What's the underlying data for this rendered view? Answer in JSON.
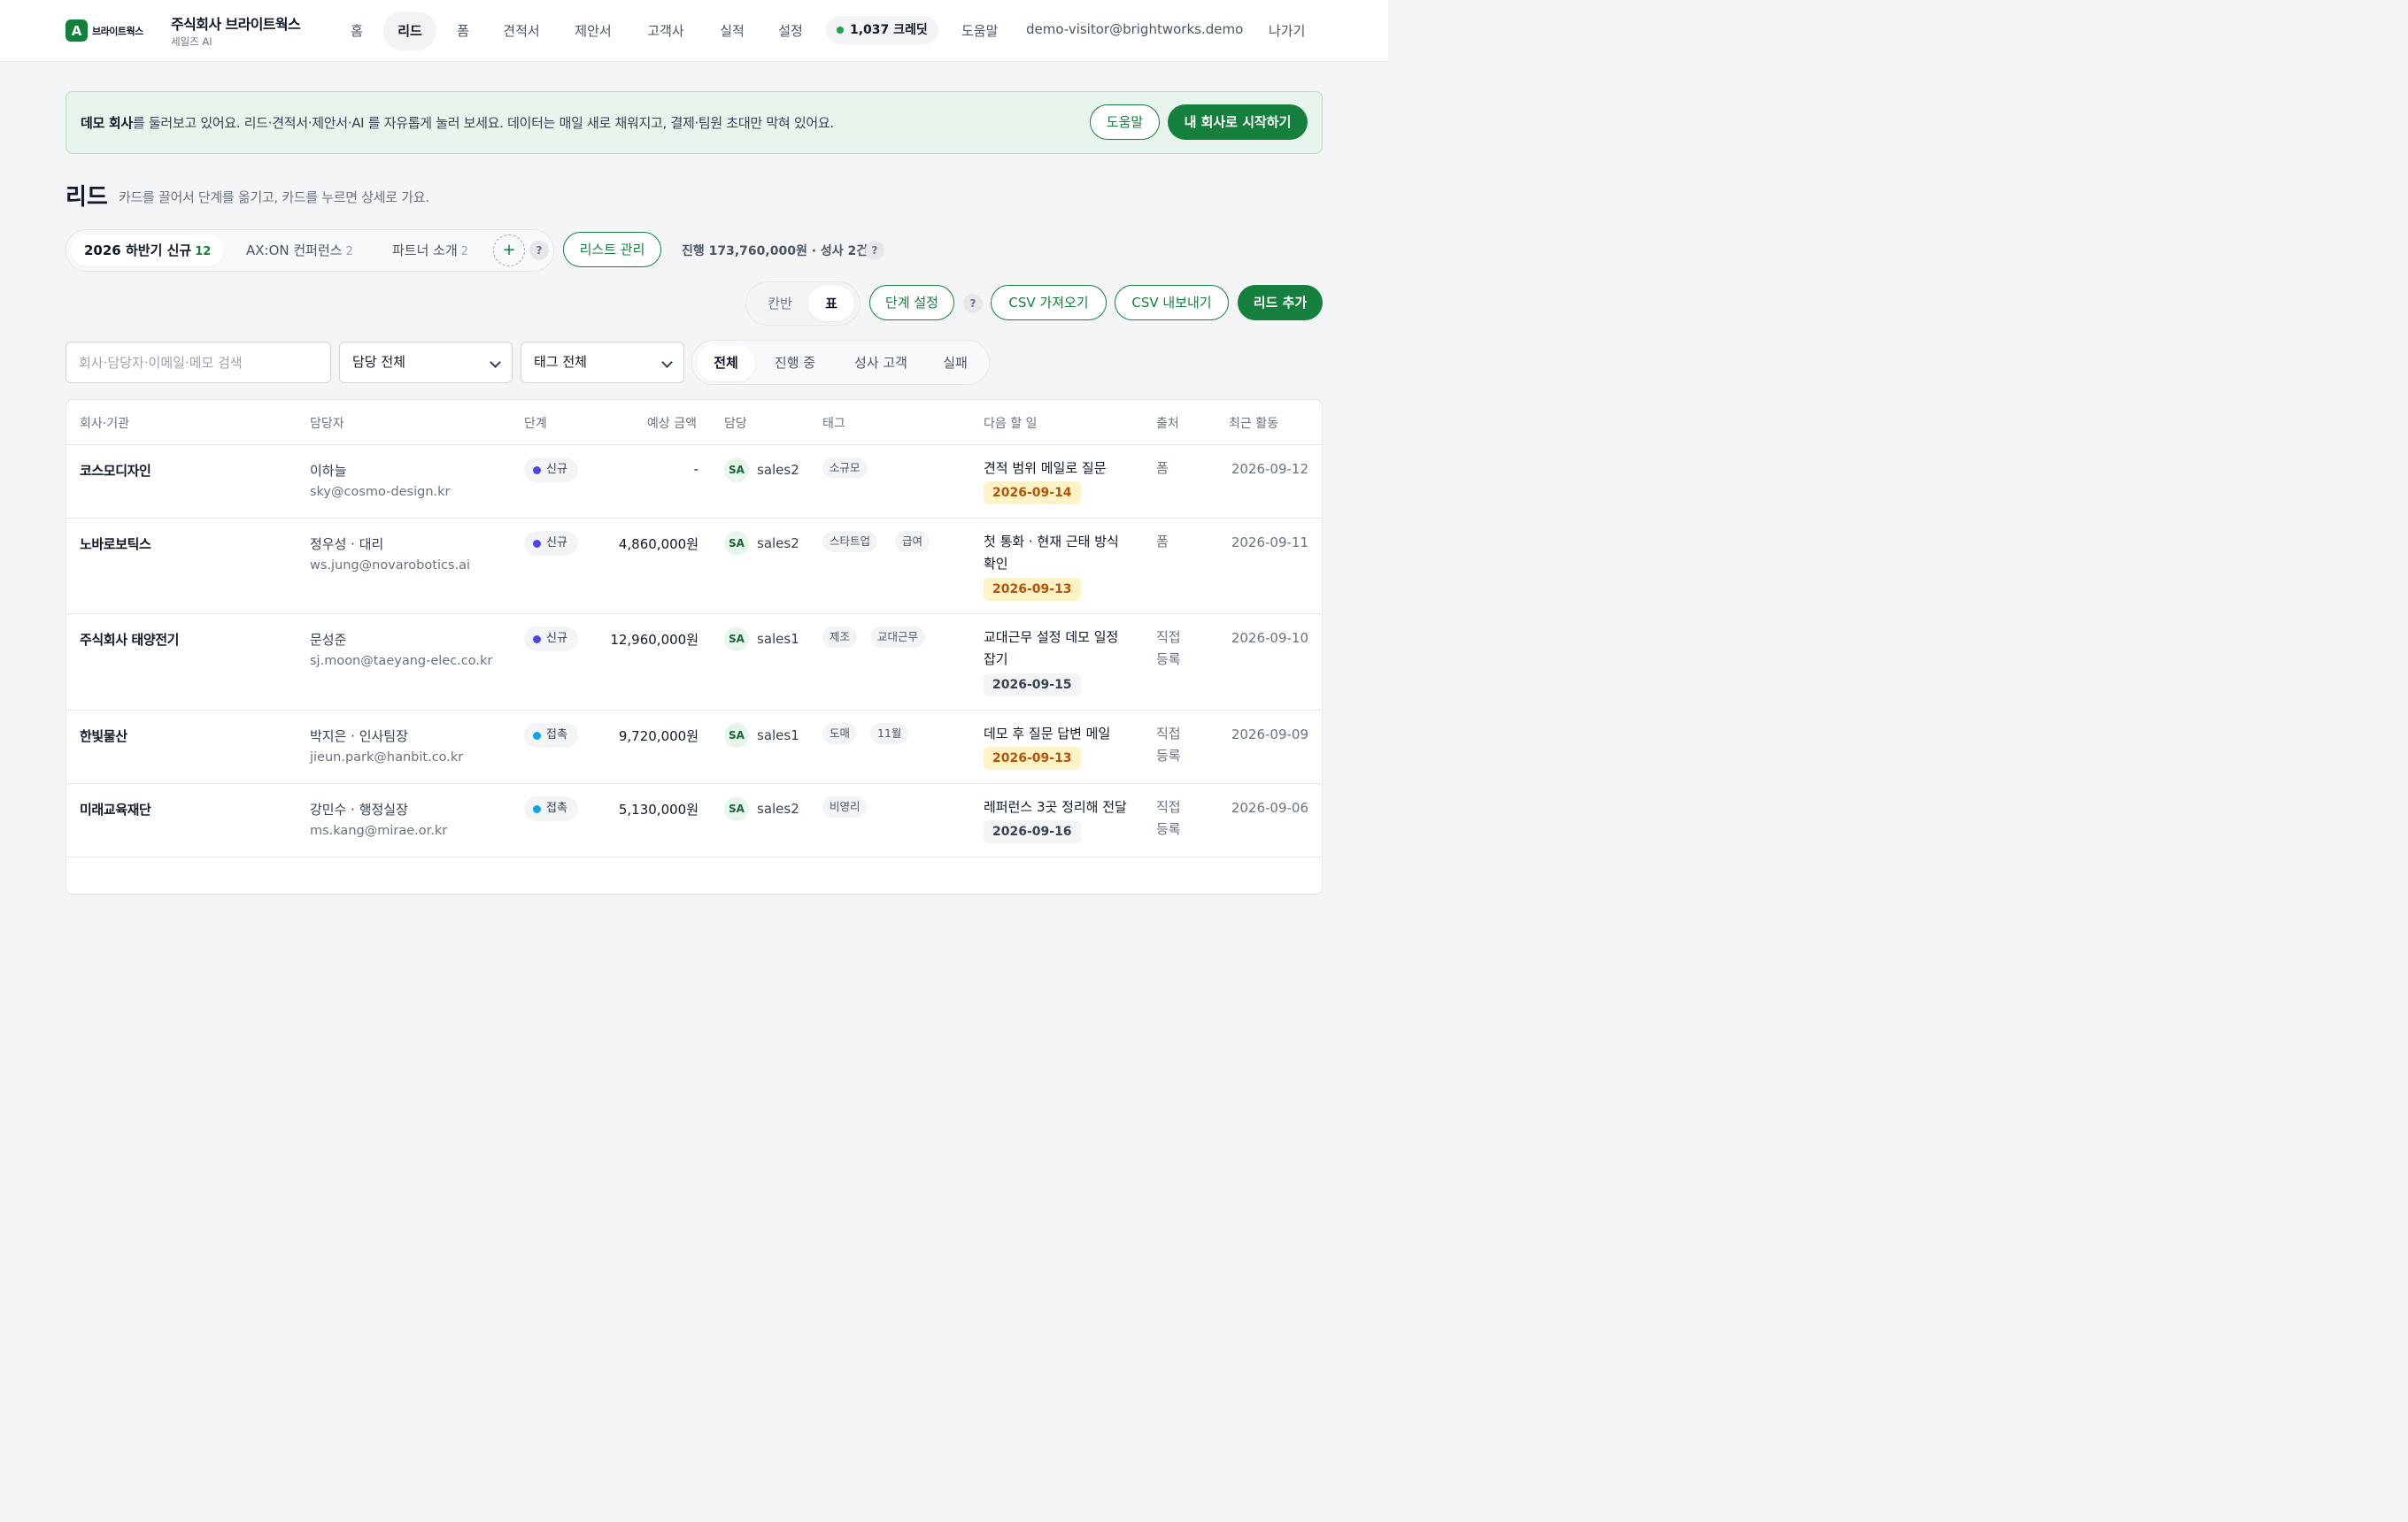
{
  "brand": {
    "logo_letter": "A",
    "logo_text": "브라이트웍스",
    "org_name": "주식회사 브라이트웍스",
    "org_sub": "세일즈 AI",
    "accent": "#15803d"
  },
  "nav": [
    "홈",
    "리드",
    "폼",
    "견적서",
    "제안서",
    "고객사",
    "실적",
    "설정"
  ],
  "credits": "1,037 크레딧",
  "top_help": "도움말",
  "user_email": "demo-visitor@brightworks.demo",
  "logout": "나가기",
  "banner": {
    "bold": "데모 회사",
    "text": "를 둘러보고 있어요. 리드·견적서·제안서·AI 를 자유롭게 눌러 보세요. 데이터는 매일 새로 채워지고, 결제·팀원 초대만 막혀 있어요.",
    "help_btn": "도움말",
    "start_btn": "내 회사로 시작하기"
  },
  "page": {
    "title": "리드",
    "subtitle": "카드를 끌어서 단계를 옮기고, 카드를 누르면 상세로 가요."
  },
  "lists": [
    {
      "label": "2026 하반기 신규",
      "count": "12"
    },
    {
      "label": "AX:ON 컨퍼런스",
      "count": "2"
    },
    {
      "label": "파트너 소개",
      "count": "2"
    }
  ],
  "add_list": "+",
  "help_q": "?",
  "list_manage": "리스트 관리",
  "stats": "진행 173,760,000원 · 성사 2건",
  "view": {
    "kanban": "칸반",
    "table": "표"
  },
  "actions": {
    "stage_settings": "단계 설정",
    "csv_import": "CSV 가져오기",
    "csv_export": "CSV 내보내기",
    "add_lead": "리드 추가"
  },
  "filters": {
    "search_placeholder": "회사·담당자·이메일·메모 검색",
    "owner": "담당 전체",
    "tag": "태그 전체",
    "status": [
      "전체",
      "진행 중",
      "성사 고객",
      "실패"
    ]
  },
  "columns": [
    "회사·기관",
    "담당자",
    "단계",
    "예상 금액",
    "담당",
    "태그",
    "다음 할 일",
    "출처",
    "최근 활동"
  ],
  "stage_colors": {
    "신규": "#4f46e5",
    "접촉": "#0ea5e9"
  },
  "rows": [
    {
      "company": "코스모디자인",
      "contact": "이하늘",
      "email": "sky@cosmo-design.kr",
      "stage": "신규",
      "amount": "-",
      "owner_initials": "SA",
      "owner": "sales2",
      "tags": [
        "소규모"
      ],
      "todo": "견적 범위 메일로 질문",
      "due": "2026-09-14",
      "due_state": "warn",
      "source": "폼",
      "recent": "2026-09-12"
    },
    {
      "company": "노바로보틱스",
      "contact": "정우성 · 대리",
      "email": "ws.jung@novarobotics.ai",
      "stage": "신규",
      "amount": "4,860,000원",
      "owner_initials": "SA",
      "owner": "sales2",
      "tags": [
        "스타트업",
        "급여"
      ],
      "todo": "첫 통화 · 현재 근태 방식 확인",
      "due": "2026-09-13",
      "due_state": "warn",
      "source": "폼",
      "recent": "2026-09-11"
    },
    {
      "company": "주식회사 태양전기",
      "contact": "문성준",
      "email": "sj.moon@taeyang-elec.co.kr",
      "stage": "신규",
      "amount": "12,960,000원",
      "owner_initials": "SA",
      "owner": "sales1",
      "tags": [
        "제조",
        "교대근무"
      ],
      "todo": "교대근무 설정 데모 일정 잡기",
      "due": "2026-09-15",
      "due_state": "normal",
      "source": "직접 등록",
      "recent": "2026-09-10"
    },
    {
      "company": "한빛물산",
      "contact": "박지은 · 인사팀장",
      "email": "jieun.park@hanbit.co.kr",
      "stage": "접촉",
      "amount": "9,720,000원",
      "owner_initials": "SA",
      "owner": "sales1",
      "tags": [
        "도매",
        "11월"
      ],
      "todo": "데모 후 질문 답변 메일",
      "due": "2026-09-13",
      "due_state": "warn",
      "source": "직접 등록",
      "recent": "2026-09-09"
    },
    {
      "company": "미래교육재단",
      "contact": "강민수 · 행정실장",
      "email": "ms.kang@mirae.or.kr",
      "stage": "접촉",
      "amount": "5,130,000원",
      "owner_initials": "SA",
      "owner": "sales2",
      "tags": [
        "비영리"
      ],
      "todo": "레퍼런스 3곳 정리해 전달",
      "due": "2026-09-16",
      "due_state": "normal",
      "source": "직접 등록",
      "recent": "2026-09-06"
    }
  ]
}
